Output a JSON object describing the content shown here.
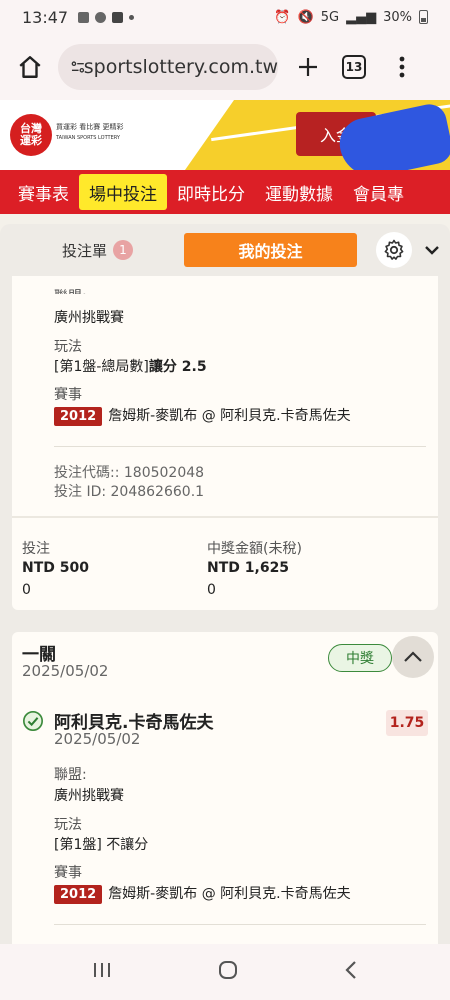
{
  "status_bar": {
    "time": "13:47",
    "signal_label": "5G",
    "battery": "30%"
  },
  "browser": {
    "url": "sportslottery.com.tw",
    "tab_count": "13"
  },
  "site": {
    "logo_text": "台灣運彩",
    "tagline_zh": "買運彩 看比賽 更精彩",
    "tagline_en": "TAIWAN SPORTS LOTTERY",
    "deposit_label": "入金"
  },
  "nav": {
    "items": [
      {
        "label": "賽事表"
      },
      {
        "label": "場中投注"
      },
      {
        "label": "即時比分"
      },
      {
        "label": "運動數據"
      },
      {
        "label": "會員專"
      }
    ]
  },
  "slip": {
    "label": "投注單",
    "badge": "1",
    "my_bets_label": "我的投注"
  },
  "bet1": {
    "league_label": "聯盟:",
    "league": "廣州挑戰賽",
    "market_label": "玩法",
    "market_prefix": "[第1盤-總局數]",
    "market_suffix": "讓分 2.5",
    "match_label": "賽事",
    "year_tag": "2012",
    "match": "詹姆斯-麥凱布 @ 阿利貝克.卡奇馬佐夫",
    "code_line": "投注代碼:: 180502048",
    "id_line": "投注 ID: 204862660.1",
    "stake_label": "投注",
    "stake_value": "NTD 500",
    "stake_sub": "0",
    "payout_label": "中獎金額(未稅)",
    "payout_value": "NTD 1,625",
    "payout_sub": "0"
  },
  "bet2": {
    "title": "一關",
    "date": "2025/05/02",
    "status": "中獎",
    "selection": "阿利貝克.卡奇馬佐夫",
    "selection_date": "2025/05/02",
    "odds": "1.75",
    "league_label": "聯盟:",
    "league": "廣州挑戰賽",
    "market_label": "玩法",
    "market_prefix": "[第1盤]",
    "market_suffix": " 不讓分",
    "match_label": "賽事",
    "year_tag": "2012",
    "match": "詹姆斯-麥凱布 @ 阿利貝克.卡奇馬佐夫"
  },
  "colors": {
    "brand_red": "#dc1f26",
    "brand_yellow": "#f6cf2b",
    "accent_orange": "#f7821b",
    "win_green": "#2e7d32"
  }
}
